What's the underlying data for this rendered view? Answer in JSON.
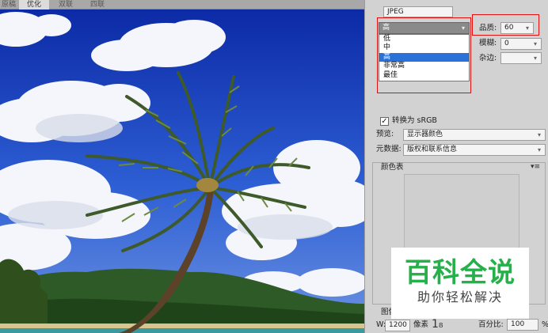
{
  "tabs": [
    {
      "label": "原稿"
    },
    {
      "label": "优化"
    },
    {
      "label": "双联"
    },
    {
      "label": "四联"
    }
  ],
  "format_value": "JPEG",
  "quality_preset": {
    "value": "高"
  },
  "quality_dropdown": {
    "options": [
      "低",
      "中",
      "高",
      "非常高",
      "最佳"
    ],
    "selected_index": 2
  },
  "quality": {
    "label": "品质:",
    "value": "60"
  },
  "blur": {
    "label": "模糊:",
    "value": "0"
  },
  "matte": {
    "label": "杂边:",
    "value": ""
  },
  "convert_srgb": {
    "label": "转换为 sRGB",
    "checked": true
  },
  "preview": {
    "label": "预览:",
    "value": "显示器颜色"
  },
  "metadata": {
    "label": "元数据:",
    "value": "版权和联系信息"
  },
  "color_table": {
    "title": "颜色表"
  },
  "image_size": {
    "title": "图像大小",
    "width_label": "W:",
    "width_value": "1200",
    "unit": "像素",
    "percent_label": "百分比:",
    "percent_value": "100",
    "percent_unit": "%"
  },
  "watermark": {
    "title": "百科全说",
    "subtitle": "助你轻松解决"
  },
  "colors": {
    "highlight": "#2a72d8",
    "annotation": "#e01010",
    "watermark_green": "#25b04a"
  }
}
